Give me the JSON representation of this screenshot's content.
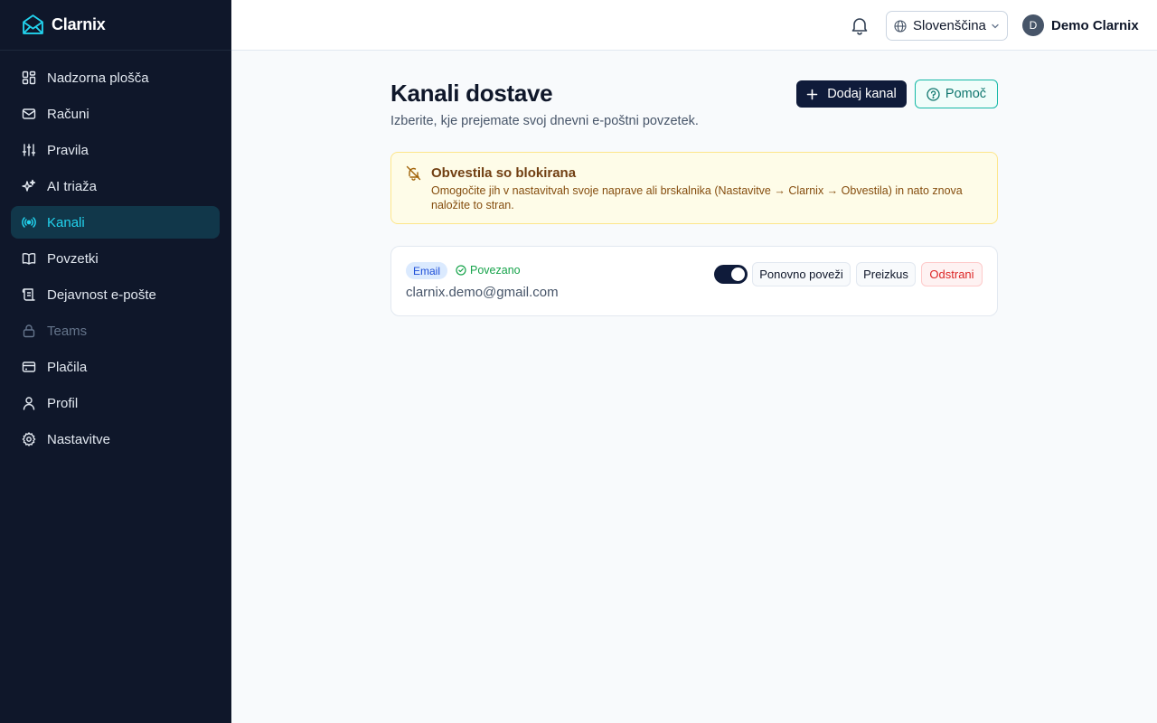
{
  "brand": {
    "name": "Clarnix"
  },
  "sidebar": {
    "items": [
      {
        "label": "Nadzorna plošča",
        "icon": "dashboard-icon"
      },
      {
        "label": "Računi",
        "icon": "mail-icon"
      },
      {
        "label": "Pravila",
        "icon": "sliders-icon"
      },
      {
        "label": "AI triaža",
        "icon": "sparkles-icon"
      },
      {
        "label": "Kanali",
        "icon": "radio-icon",
        "active": true
      },
      {
        "label": "Povzetki",
        "icon": "book-icon"
      },
      {
        "label": "Dejavnost e-pošte",
        "icon": "scroll-icon"
      },
      {
        "label": "Teams",
        "icon": "lock-icon",
        "disabled": true
      },
      {
        "label": "Plačila",
        "icon": "credit-card-icon"
      },
      {
        "label": "Profil",
        "icon": "user-icon"
      },
      {
        "label": "Nastavitve",
        "icon": "gear-icon"
      }
    ]
  },
  "header": {
    "language": "Slovenščina",
    "user": {
      "initial": "D",
      "name": "Demo Clarnix"
    }
  },
  "main": {
    "title": "Kanali dostave",
    "subtitle": "Izberite, kje prejemate svoj dnevni e-poštni povzetek.",
    "add_label": "Dodaj kanal",
    "help_label": "Pomoč",
    "alert": {
      "title": "Obvestila so blokirana",
      "text": "Omogočite jih v nastavitvah svoje naprave ali brskalnika (Nastavitve → Clarnix → Obvestila) in nato znova naložite to stran."
    },
    "channel": {
      "type": "Email",
      "status": "Povezano",
      "address": "clarnix.demo@gmail.com",
      "enabled": true,
      "reconnect_label": "Ponovno poveži",
      "test_label": "Preizkus",
      "remove_label": "Odstrani"
    }
  },
  "colors": {
    "sidebar_bg": "#0f172a",
    "accent": "#22d3ee",
    "primary_button": "#0f1b3a",
    "help_border": "#14b8a6",
    "alert_bg": "#fefce8",
    "success": "#16a34a",
    "danger": "#dc2626"
  }
}
